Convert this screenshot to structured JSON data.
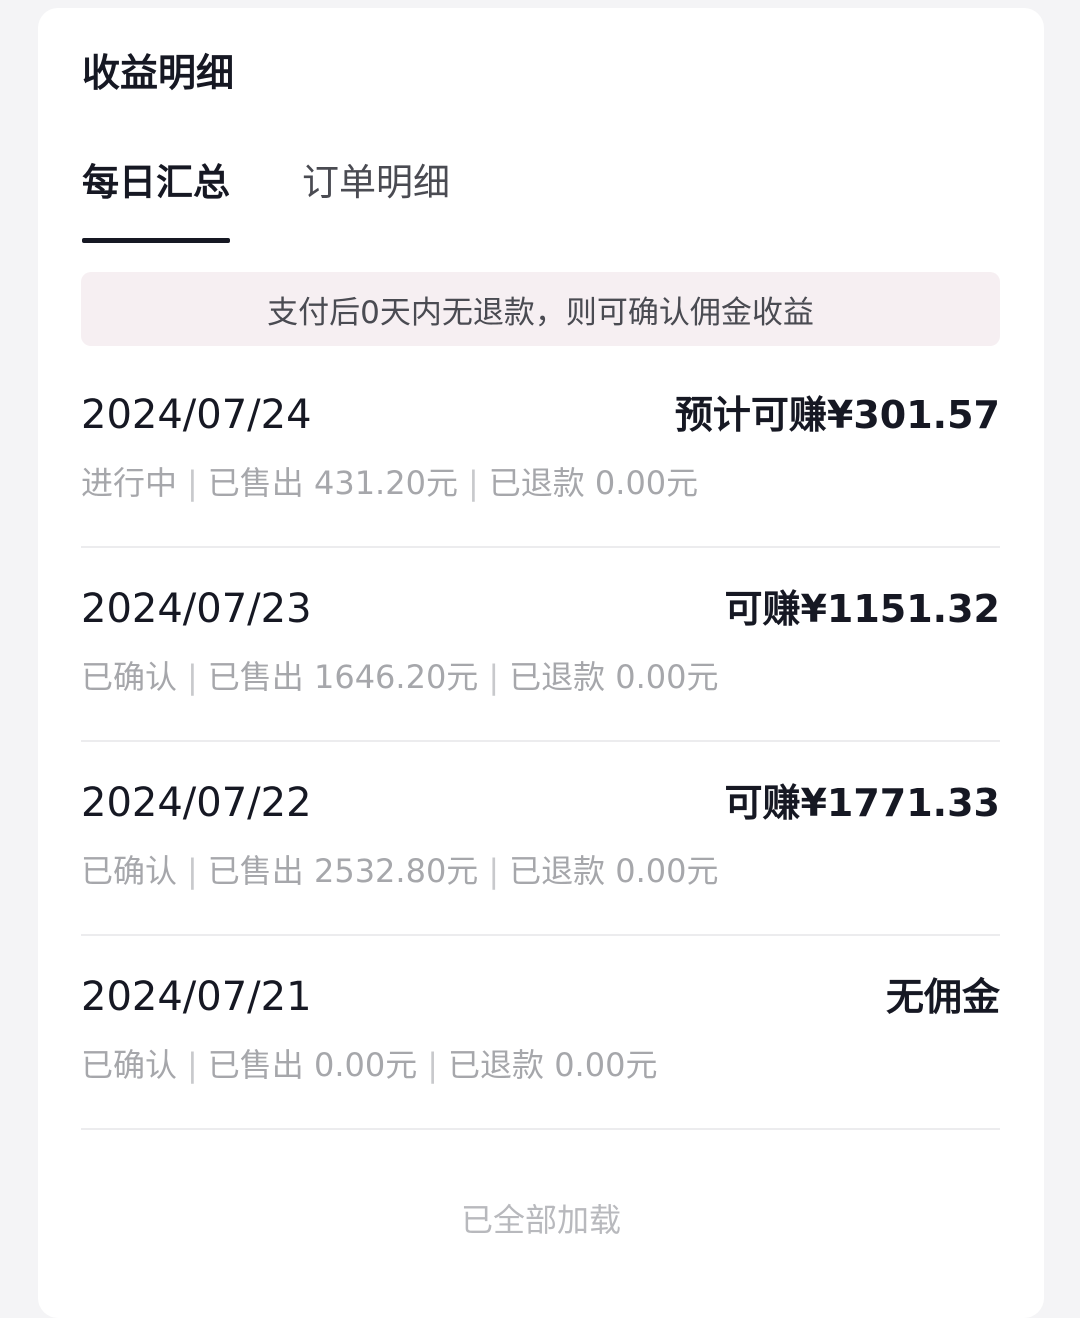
{
  "page": {
    "title": "收益明细",
    "tabs": [
      {
        "label": "每日汇总",
        "active": true
      },
      {
        "label": "订单明细",
        "active": false
      }
    ],
    "notice": "支付后0天内无退款，则可确认佣金收益",
    "rows": [
      {
        "date": "2024/07/24",
        "amount": "预计可赚¥301.57",
        "status": "进行中",
        "sold": "已售出 431.20元",
        "refunded": "已退款 0.00元"
      },
      {
        "date": "2024/07/23",
        "amount": "可赚¥1151.32",
        "status": "已确认",
        "sold": "已售出 1646.20元",
        "refunded": "已退款 0.00元"
      },
      {
        "date": "2024/07/22",
        "amount": "可赚¥1771.33",
        "status": "已确认",
        "sold": "已售出 2532.80元",
        "refunded": "已退款 0.00元"
      },
      {
        "date": "2024/07/21",
        "amount": "无佣金",
        "status": "已确认",
        "sold": "已售出 0.00元",
        "refunded": "已退款 0.00元"
      }
    ],
    "footer": "已全部加载",
    "separator": "|"
  },
  "colors": {
    "background": "#f4f4f6",
    "card": "#ffffff",
    "primary_text": "#161823",
    "secondary_text": "#a6a7ab",
    "notice_bg": "#f6eff2",
    "divider": "#ececee"
  }
}
